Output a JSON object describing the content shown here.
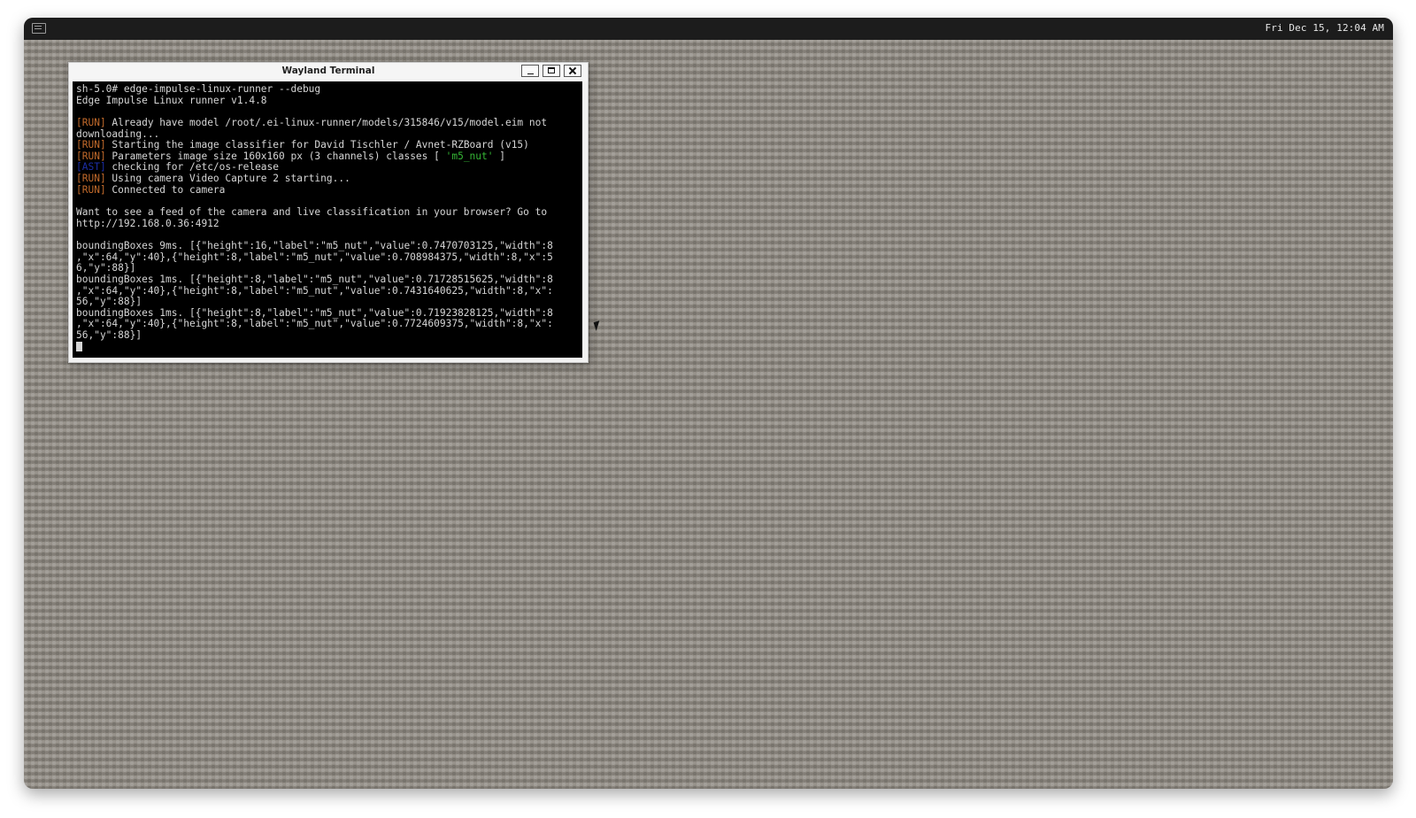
{
  "panel": {
    "clock": "Fri Dec 15, 12:04 AM",
    "launcher_icon": "terminal-icon"
  },
  "window": {
    "title": "Wayland Terminal",
    "buttons": [
      "minimize-icon",
      "maximize-icon",
      "close-icon"
    ]
  },
  "terminal": {
    "lines": [
      {
        "tag": "",
        "text": "sh-5.0# edge-impulse-linux-runner --debug"
      },
      {
        "tag": "",
        "text": "Edge Impulse Linux runner v1.4.8"
      },
      {
        "tag": "",
        "text": ""
      },
      {
        "tag": "[RUN]",
        "text": " Already have model /root/.ei-linux-runner/models/315846/v15/model.eim not"
      },
      {
        "tag": "",
        "text": "downloading..."
      },
      {
        "tag": "[RUN]",
        "text": " Starting the image classifier for David Tischler / Avnet-RZBoard (v15)"
      },
      {
        "tag": "[RUN]",
        "text": " Parameters image size 160x160 px (3 channels) classes [ ",
        "green": "'m5_nut'",
        "after": " ]"
      },
      {
        "tag": "[AST]",
        "text": " checking for /etc/os-release"
      },
      {
        "tag": "[RUN]",
        "text": " Using camera Video Capture 2 starting..."
      },
      {
        "tag": "[RUN]",
        "text": " Connected to camera"
      },
      {
        "tag": "",
        "text": ""
      },
      {
        "tag": "",
        "text": "Want to see a feed of the camera and live classification in your browser? Go to"
      },
      {
        "tag": "",
        "text": "http://192.168.0.36:4912"
      },
      {
        "tag": "",
        "text": ""
      },
      {
        "tag": "",
        "text": "boundingBoxes 9ms. [{\"height\":16,\"label\":\"m5_nut\",\"value\":0.7470703125,\"width\":8"
      },
      {
        "tag": "",
        "text": ",\"x\":64,\"y\":40},{\"height\":8,\"label\":\"m5_nut\",\"value\":0.708984375,\"width\":8,\"x\":5"
      },
      {
        "tag": "",
        "text": "6,\"y\":88}]"
      },
      {
        "tag": "",
        "text": "boundingBoxes 1ms. [{\"height\":8,\"label\":\"m5_nut\",\"value\":0.71728515625,\"width\":8"
      },
      {
        "tag": "",
        "text": ",\"x\":64,\"y\":40},{\"height\":8,\"label\":\"m5_nut\",\"value\":0.7431640625,\"width\":8,\"x\":"
      },
      {
        "tag": "",
        "text": "56,\"y\":88}]"
      },
      {
        "tag": "",
        "text": "boundingBoxes 1ms. [{\"height\":8,\"label\":\"m5_nut\",\"value\":0.71923828125,\"width\":8"
      },
      {
        "tag": "",
        "text": ",\"x\":64,\"y\":40},{\"height\":8,\"label\":\"m5_nut\",\"value\":0.7724609375,\"width\":8,\"x\":"
      },
      {
        "tag": "",
        "text": "56,\"y\":88}]"
      }
    ]
  },
  "colors": {
    "run_tag": "#c26a2b",
    "ast_tag": "#1c2ea6",
    "class_highlight": "#35b535",
    "terminal_bg": "#000000",
    "terminal_fg": "#d6d6d6"
  }
}
